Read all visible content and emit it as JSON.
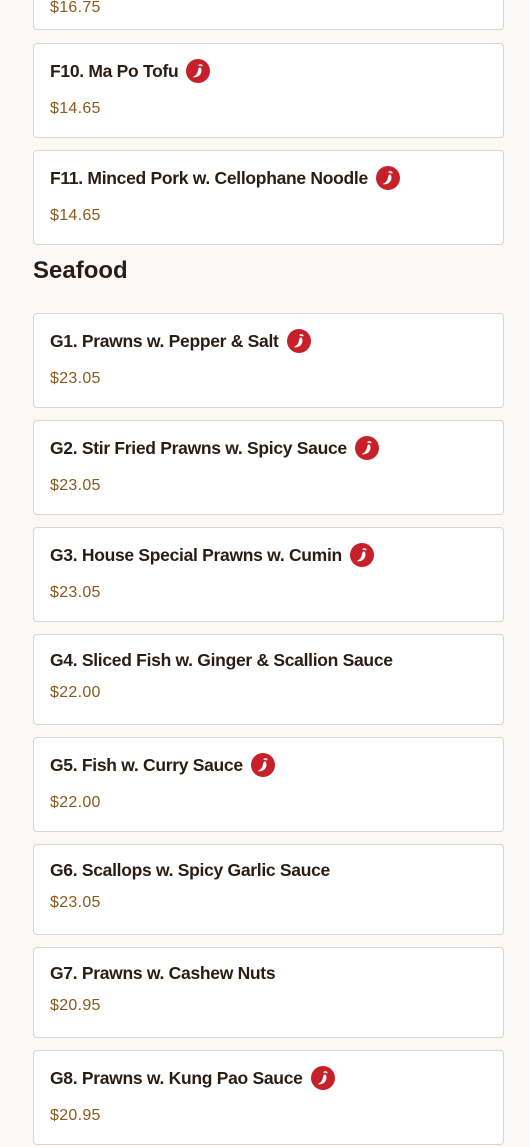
{
  "items_top": [
    {
      "price": "$16.75"
    },
    {
      "name": "F10. Ma Po Tofu",
      "price": "$14.65",
      "spicy": true
    },
    {
      "name": "F11. Minced Pork w. Cellophane Noodle",
      "price": "$14.65",
      "spicy": true
    }
  ],
  "seafood": {
    "title": "Seafood",
    "items": [
      {
        "name": "G1. Prawns w. Pepper & Salt",
        "price": "$23.05",
        "spicy": true
      },
      {
        "name": "G2. Stir Fried Prawns w. Spicy Sauce",
        "price": "$23.05",
        "spicy": true
      },
      {
        "name": "G3. House Special Prawns w. Cumin",
        "price": "$23.05",
        "spicy": true
      },
      {
        "name": "G4. Sliced Fish w. Ginger & Scallion Sauce",
        "price": "$22.00",
        "spicy": false
      },
      {
        "name": "G5. Fish w. Curry Sauce",
        "price": "$22.00",
        "spicy": true
      },
      {
        "name": "G6. Scallops w. Spicy Garlic Sauce",
        "price": "$23.05",
        "spicy": false
      },
      {
        "name": "G7. Prawns w. Cashew Nuts",
        "price": "$20.95",
        "spicy": false
      },
      {
        "name": "G8. Prawns w. Kung Pao Sauce",
        "price": "$20.95",
        "spicy": true
      }
    ]
  },
  "colors": {
    "accent_price": "#8a5a1c",
    "spicy_icon": "#c8202a"
  },
  "icons": {
    "spicy": "chili-pepper-icon"
  }
}
